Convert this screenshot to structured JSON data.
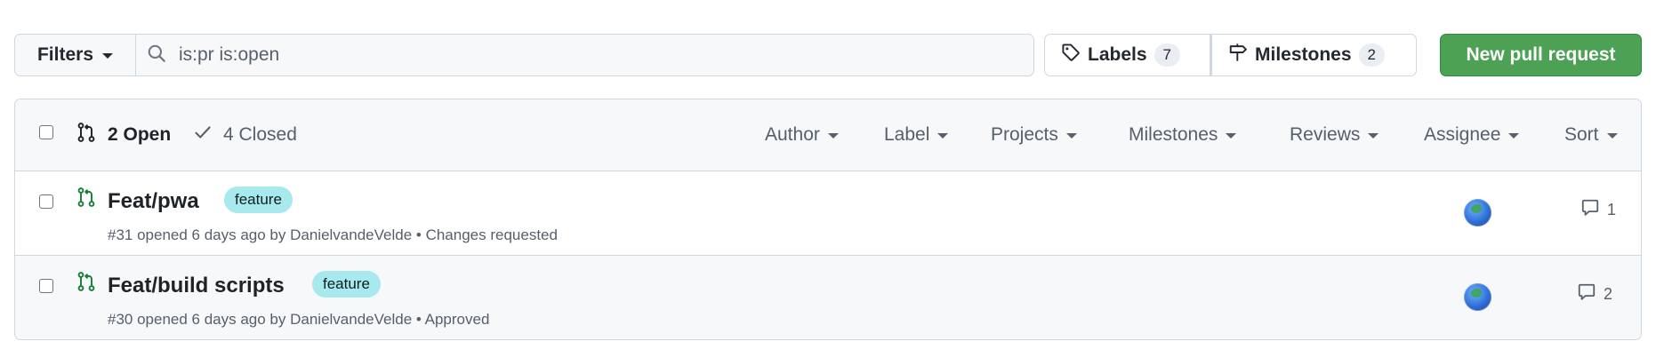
{
  "toolbar": {
    "filters_label": "Filters",
    "search_value": "is:pr is:open",
    "labels_label": "Labels",
    "labels_count": "7",
    "milestones_label": "Milestones",
    "milestones_count": "2",
    "new_pr_label": "New pull request",
    "new_pr_color": "#4ca155"
  },
  "list_header": {
    "open_label": "2 Open",
    "closed_label": "4 Closed",
    "filters": [
      "Author",
      "Label",
      "Projects",
      "Milestones",
      "Reviews",
      "Assignee",
      "Sort"
    ]
  },
  "pull_requests": [
    {
      "title": "Feat/pwa",
      "label": "feature",
      "meta": "#31 opened 6 days ago by DanielvandeVelde • Changes requested",
      "comments": "1"
    },
    {
      "title": "Feat/build scripts",
      "label": "feature",
      "meta": "#30 opened 6 days ago by DanielvandeVelde • Approved",
      "comments": "2"
    }
  ],
  "colors": {
    "pr_open_icon": "#1a7f37",
    "label_bg": "#a8e9ee"
  },
  "icons": {
    "search": "search-icon",
    "tag": "tag-icon",
    "milestone": "milestone-icon",
    "pr_open": "git-pull-request-icon",
    "check": "check-icon",
    "comment": "comment-icon"
  }
}
